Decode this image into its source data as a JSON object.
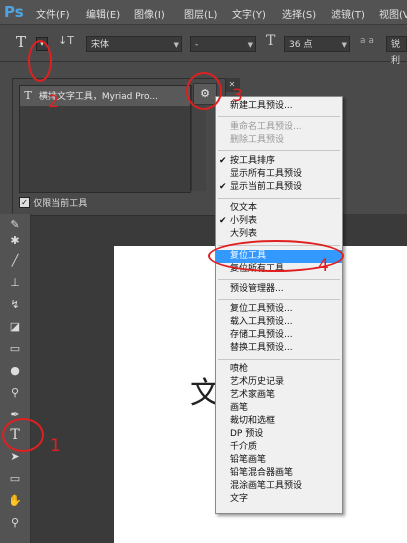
{
  "app": {
    "logo": "Ps"
  },
  "menubar": {
    "items": [
      "文件(F)",
      "编辑(E)",
      "图像(I)",
      "图层(L)",
      "文字(Y)",
      "选择(S)",
      "滤镜(T)",
      "视图(V)"
    ]
  },
  "options_bar": {
    "tool_glyph": "T",
    "orient_glyph": "↓T",
    "font_family": "宋体",
    "font_style": "-",
    "size_glyph": "T",
    "font_size": "36 点",
    "aa_glyph": "a a",
    "aa_mode": "锐利"
  },
  "preset_panel": {
    "item_label": "横排文字工具，Myriad Pro...",
    "current_only_label": "仅限当前工具",
    "current_only_checked": true
  },
  "canvas": {
    "text": "文"
  },
  "context_menu": {
    "items": [
      {
        "label": "新建工具预设...",
        "state": "normal"
      },
      {
        "label": "重命名工具预设...",
        "state": "disabled"
      },
      {
        "label": "删除工具预设",
        "state": "disabled"
      },
      {
        "label": "按工具排序",
        "state": "checked"
      },
      {
        "label": "显示所有工具预设",
        "state": "normal"
      },
      {
        "label": "显示当前工具预设",
        "state": "checked"
      },
      {
        "label": "仅文本",
        "state": "normal"
      },
      {
        "label": "小列表",
        "state": "checked"
      },
      {
        "label": "大列表",
        "state": "normal"
      },
      {
        "label": "复位工具",
        "state": "highlighted"
      },
      {
        "label": "复位所有工具",
        "state": "normal"
      },
      {
        "label": "预设管理器...",
        "state": "normal"
      },
      {
        "label": "复位工具预设...",
        "state": "normal"
      },
      {
        "label": "载入工具预设...",
        "state": "normal"
      },
      {
        "label": "存储工具预设...",
        "state": "normal"
      },
      {
        "label": "替换工具预设...",
        "state": "normal"
      },
      {
        "label": "喷枪",
        "state": "normal"
      },
      {
        "label": "艺术历史记录",
        "state": "normal"
      },
      {
        "label": "艺术家画笔",
        "state": "normal"
      },
      {
        "label": "画笔",
        "state": "normal"
      },
      {
        "label": "裁切和选框",
        "state": "normal"
      },
      {
        "label": "DP 预设",
        "state": "normal"
      },
      {
        "label": "千介质",
        "state": "normal"
      },
      {
        "label": "铅笔画笔",
        "state": "normal"
      },
      {
        "label": "铅笔混合器画笔",
        "state": "normal"
      },
      {
        "label": "混涂画笔工具预设",
        "state": "normal"
      },
      {
        "label": "文字",
        "state": "normal"
      }
    ]
  },
  "annotations": {
    "n1": "1",
    "n2": "2",
    "n3": "3",
    "n4": "4"
  },
  "colors": {
    "annotation": "#e02020",
    "highlight": "#3399ff"
  }
}
